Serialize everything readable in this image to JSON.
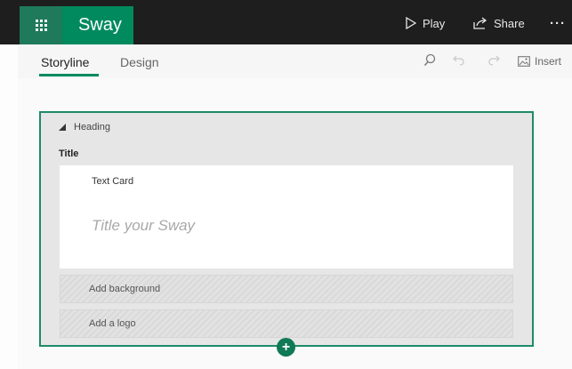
{
  "app": {
    "title": "Sway"
  },
  "header": {
    "play_label": "Play",
    "share_label": "Share",
    "more_label": "···"
  },
  "toolbar": {
    "tabs": [
      {
        "label": "Storyline",
        "active": true
      },
      {
        "label": "Design",
        "active": false
      }
    ],
    "insert_label": "Insert"
  },
  "storyline": {
    "heading_label": "Heading",
    "title_label": "Title",
    "text_card": {
      "label": "Text Card",
      "placeholder": "Title your Sway"
    },
    "add_background_label": "Add background",
    "add_logo_label": "Add a logo",
    "add_button_label": "+"
  },
  "colors": {
    "accent": "#008a5e",
    "frame": "#1f8a6b",
    "topbar": "#1e1e1e"
  },
  "icons": [
    "app-launcher-icon",
    "play-icon",
    "share-icon",
    "more-icon",
    "search-icon",
    "undo-icon",
    "redo-icon",
    "image-icon",
    "collapse-triangle-icon",
    "add-icon"
  ]
}
